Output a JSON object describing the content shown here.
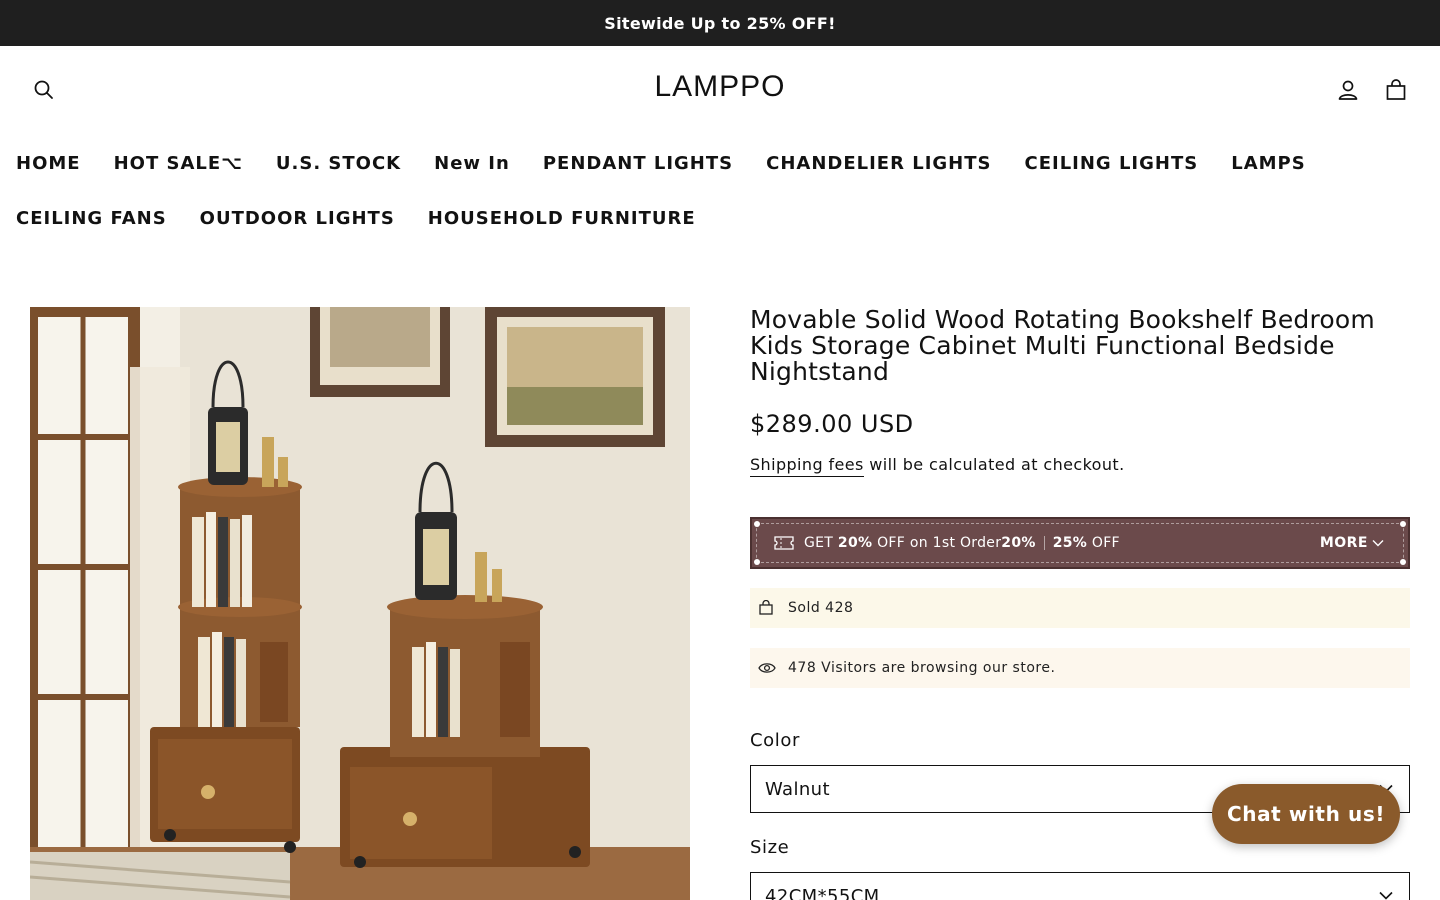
{
  "announcement": {
    "text": "Sitewide Up to 25% OFF!"
  },
  "header": {
    "logo": "LAMPPO",
    "icons": [
      "search-icon",
      "account-icon",
      "cart-icon"
    ]
  },
  "nav": {
    "row1": [
      "HOME",
      "HOT SALE⌥",
      "U.S. STOCK",
      "New In",
      "PENDANT LIGHTS",
      "CHANDELIER LIGHTS",
      "CEILING LIGHTS",
      "LAMPS"
    ],
    "row2": [
      "CEILING FANS",
      "OUTDOOR LIGHTS",
      "HOUSEHOLD FURNITURE"
    ]
  },
  "product": {
    "title": "Movable Solid Wood Rotating Bookshelf Bedroom Kids Storage Cabinet Multi Functional Bedside Nightstand",
    "price": "$289.00 USD",
    "shipping_link": "Shipping fees",
    "shipping_text": " will be calculated at checkout.",
    "coupon": {
      "get": "GET ",
      "pct1": "20%",
      "mid": " OFF on 1st Order",
      "pct2": "20%",
      "pct3": "25%",
      "off": " OFF",
      "more": "MORE"
    },
    "sold": "Sold 428",
    "visitors": "478 Visitors are browsing our store.",
    "color_label": "Color",
    "color_value": "Walnut",
    "size_label": "Size",
    "size_value": "42CM*55CM"
  },
  "chat": {
    "label": "Chat with us!"
  },
  "colors": {
    "announcement_bg": "#1f1f1f",
    "coupon_bg": "#6b4a4b",
    "chat_bg": "#8a5a2b",
    "sold_bg": "#fcf8e9",
    "visit_bg": "#fdf7ed"
  }
}
